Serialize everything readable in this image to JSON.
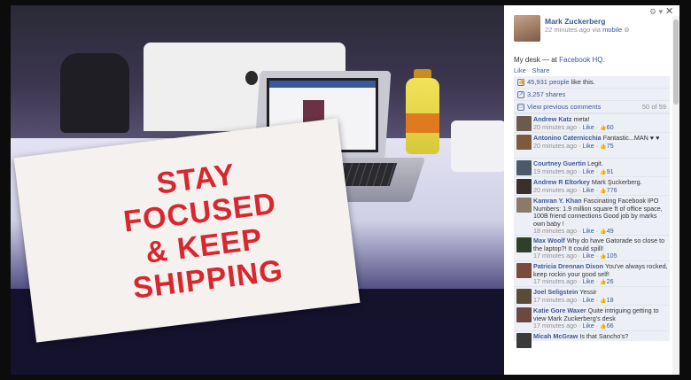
{
  "panel": {
    "author": {
      "name": "Mark Zuckerberg",
      "time": "22 minutes ago via",
      "via": "mobile"
    },
    "caption": {
      "text": "My desk — at",
      "place": "Facebook HQ."
    },
    "actions": {
      "like": "Like",
      "sep": "·",
      "share": "Share"
    },
    "likes": {
      "count": "45,931 people",
      "suffix": "like this."
    },
    "shares": "3,257 shares",
    "view_previous": "View previous comments",
    "comment_count": "50 of 59",
    "comments": [
      {
        "name": "Andrew Katz",
        "text": "meta!",
        "time": "20 minutes ago · ",
        "like": "Like",
        "likes": "60",
        "avatar": "#6d5a4e"
      },
      {
        "name": "Antonino Caternicchia",
        "text": "Fantastic...MAN ♥ ♥",
        "time": "20 minutes ago · ",
        "like": "Like",
        "likes": "75",
        "avatar": "#7b5b3c"
      },
      {
        "name": "Courtney Guertin",
        "text": "Legit.",
        "time": "19 minutes ago · ",
        "like": "Like",
        "likes": "91",
        "avatar": "#4a5a6a"
      },
      {
        "name": "Andrew R Eltorkey",
        "text": "Mark Şuckerberg.",
        "time": "20 minutes ago · ",
        "like": "Like",
        "likes": "776",
        "avatar": "#3a2f2a"
      },
      {
        "name": "Kamran Y. Khan",
        "text": "Fascinating Facebook IPO Numbers: 1.9 million square ft of office space, 100B friend connections Good job by marks own baby !",
        "time": "18 minutes ago · ",
        "like": "Like",
        "likes": "49",
        "avatar": "#8a7a6a"
      },
      {
        "name": "Max Woolf",
        "text": "Why do have Gatorade so close to the laptop?! It could spill!",
        "time": "17 minutes ago · ",
        "like": "Like",
        "likes": "105",
        "avatar": "#2e3f2a"
      },
      {
        "name": "Patricia Drennan Dixon",
        "text": "You've always rocked, keep rockin your good self!",
        "time": "17 minutes ago · ",
        "like": "Like",
        "likes": "26",
        "avatar": "#7a4a3a"
      },
      {
        "name": "Joel Seligstein",
        "text": "Yessir",
        "time": "17 minutes ago · ",
        "like": "Like",
        "likes": "18",
        "avatar": "#5a4a3a"
      },
      {
        "name": "Katie Gore Waxer",
        "text": "Quite intriguing getting to view Mark Zuckerberg's desk",
        "time": "17 minutes ago · ",
        "like": "Like",
        "likes": "66",
        "avatar": "#6a4a40"
      },
      {
        "name": "Micah McGraw",
        "text": "Is that Sancho's?",
        "time": "",
        "like": "",
        "likes": "",
        "avatar": "#3a3a3a"
      }
    ]
  },
  "poster": {
    "line1": "STAY",
    "line2": "FOCUSED",
    "line3": "& KEEP",
    "line4": "SHIPPING"
  },
  "icons": {
    "gear": "gear-icon",
    "close": "close-icon",
    "thumb": "thumbs-up-icon",
    "share": "share-icon",
    "comment": "comment-icon"
  },
  "colors": {
    "link": "#3b5998",
    "panel_bg": "#ffffff",
    "meta": "#8f8f8f",
    "poster_red": "#d8272e"
  }
}
